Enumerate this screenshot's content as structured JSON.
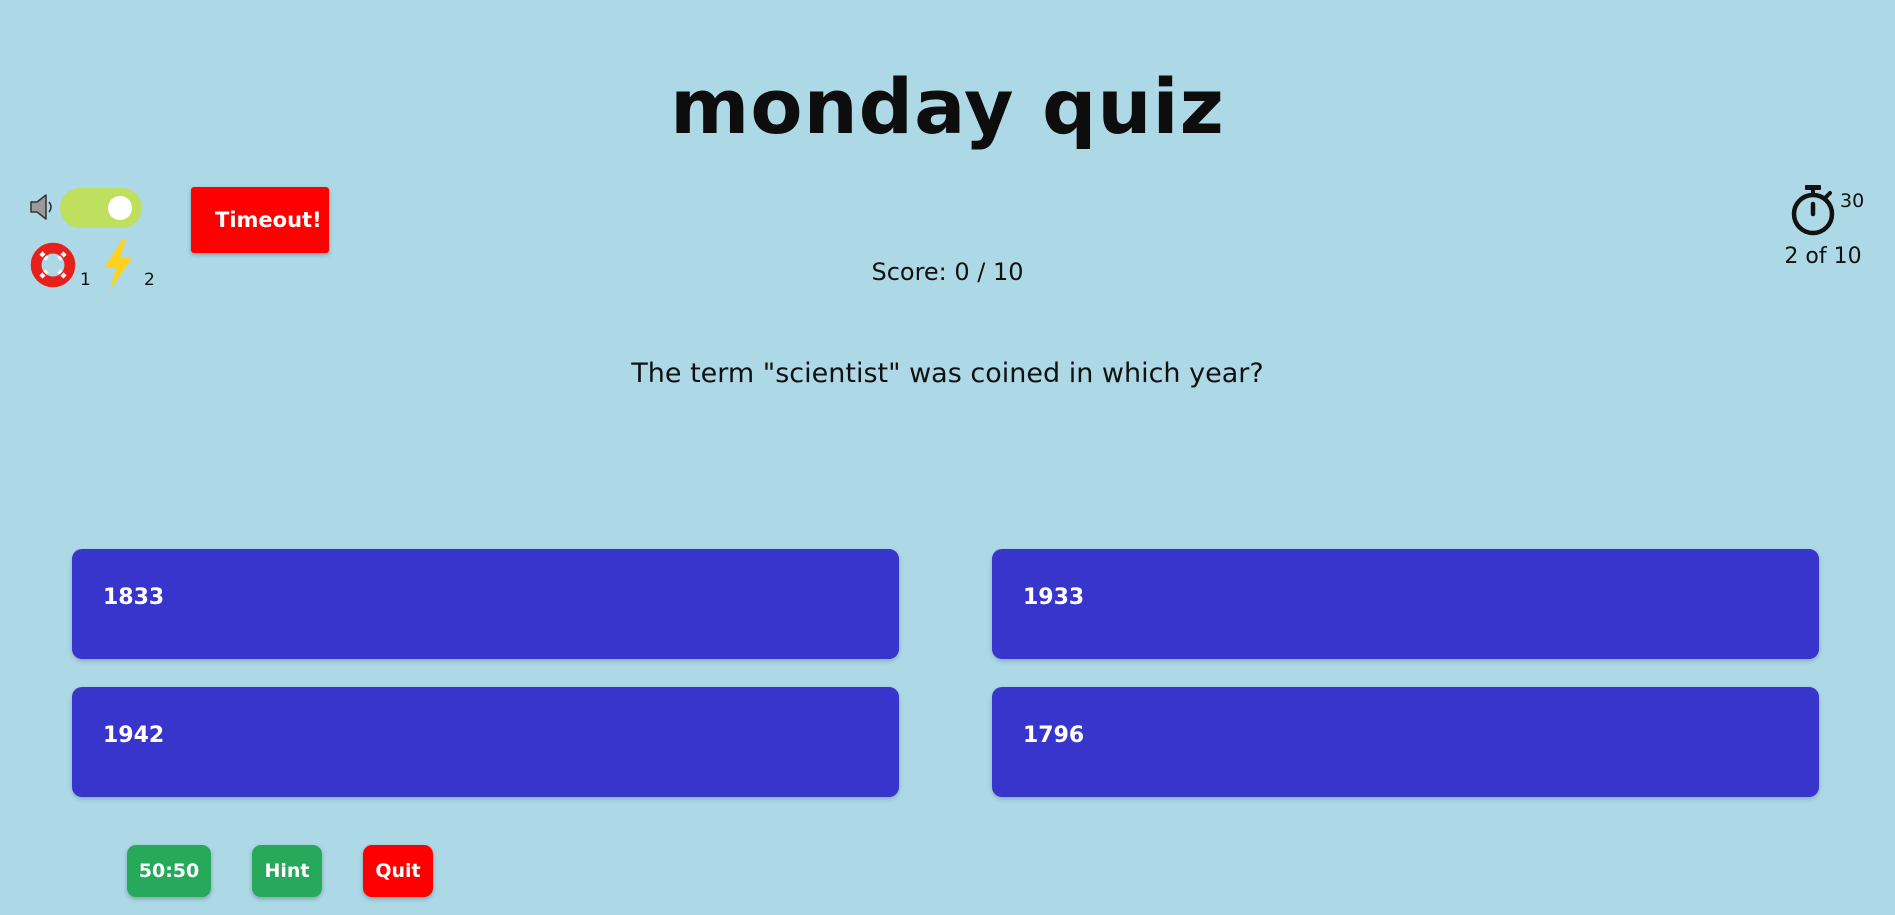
{
  "quiz": {
    "title": "monday quiz",
    "score_text": "Score: 0 / 10",
    "question": "The term \"scientist\" was coined in which year?",
    "progress_text": "2 of 10",
    "timer_seconds": "30"
  },
  "controls": {
    "sound_on": true,
    "timeout_label": "Timeout!",
    "lifelines_count": "1",
    "boosts_count": "2"
  },
  "answers": [
    {
      "label": "1833"
    },
    {
      "label": "1933"
    },
    {
      "label": "1942"
    },
    {
      "label": "1796"
    }
  ],
  "actions": {
    "fifty_fifty_label": "50:50",
    "hint_label": "Hint",
    "quit_label": "Quit"
  },
  "icons": {
    "sound": "speaker-icon",
    "lifeline": "lifebuoy-icon",
    "boost": "lightning-bolt-icon",
    "timer": "stopwatch-icon"
  },
  "colors": {
    "background": "#add8e6",
    "answer": "#3835cc",
    "primary_action": "#27a95b",
    "danger": "#ff0000",
    "toggle": "#bfdf5e",
    "bolt": "#ffd21f"
  }
}
